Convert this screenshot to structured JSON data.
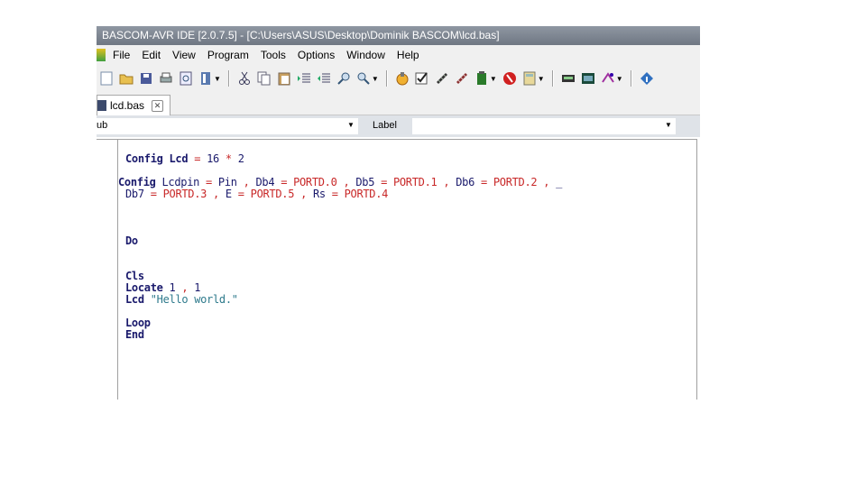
{
  "window": {
    "title": "BASCOM-AVR IDE [2.0.7.5] - [C:\\Users\\ASUS\\Desktop\\Dominik BASCOM\\lcd.bas]"
  },
  "menu": [
    "File",
    "Edit",
    "View",
    "Program",
    "Tools",
    "Options",
    "Window",
    "Help"
  ],
  "toolbar": {
    "icons": [
      "new-file-icon",
      "open-folder-icon",
      "save-icon",
      "print-icon",
      "print-preview-icon",
      "bookmark-icon",
      "cut-icon",
      "copy-icon",
      "paste-icon",
      "indent-icon",
      "unindent-icon",
      "find-icon",
      "find-next-icon",
      "program-chip-icon",
      "syntax-check-icon",
      "compile-icon",
      "chip-program-icon",
      "terminal-icon",
      "stop-icon",
      "calculator-icon",
      "lcd-designer-icon",
      "lcd-icon",
      "config-icon",
      "info-icon"
    ]
  },
  "tabs": [
    {
      "label": "lcd.bas",
      "active": true
    }
  ],
  "navbar": {
    "sub_value": "ub",
    "label_caption": "Label",
    "label_value": ""
  },
  "code": {
    "line1": [
      "Config",
      "Lcd",
      "=",
      "16",
      "*",
      "2"
    ],
    "line2": [
      "Config",
      "Lcdpin",
      "=",
      "Pin",
      ",",
      "Db4",
      "=",
      "PORTD.0",
      ",",
      "Db5",
      "=",
      "PORTD.1",
      ",",
      "Db6",
      "=",
      "PORTD.2",
      ",",
      "_"
    ],
    "line3": [
      "Db7",
      "=",
      "PORTD.3",
      ",",
      "E",
      "=",
      "PORTD.5",
      ",",
      "Rs",
      "=",
      "PORTD.4"
    ],
    "do": "Do",
    "cls": "Cls",
    "locate": [
      "Locate",
      "1",
      ",",
      "1"
    ],
    "lcd": [
      "Lcd",
      "\"Hello world.\""
    ],
    "loop": "Loop",
    "end": "End"
  },
  "colors": {
    "keyword": "#1a1a6c",
    "operator": "#c82828",
    "string": "#2e7a8c",
    "titlebar": "#7b838e"
  }
}
